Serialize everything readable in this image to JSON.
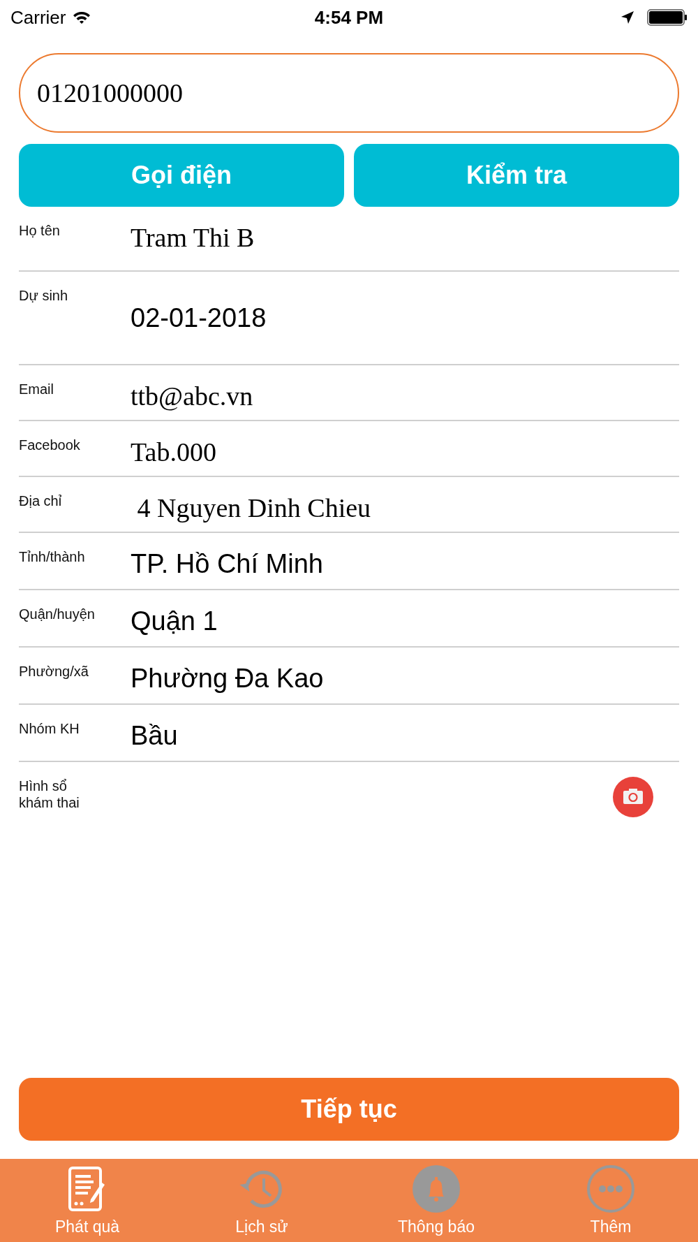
{
  "status_bar": {
    "carrier": "Carrier",
    "time": "4:54 PM"
  },
  "phone_field": {
    "value": "01201000000"
  },
  "action_buttons": [
    "Gọi điện",
    "Kiểm tra"
  ],
  "fields": [
    {
      "label": "Họ tên",
      "value": "Tram Thi B",
      "kind": "input"
    },
    {
      "label": "Dự sinh",
      "value": "02-01-2018",
      "kind": "picker",
      "tall": true
    },
    {
      "label": "Email",
      "value": "ttb@abc.vn",
      "kind": "input"
    },
    {
      "label": "Facebook",
      "value": "Tab.000",
      "kind": "input"
    },
    {
      "label": "Địa chỉ",
      "value": " 4 Nguyen Dinh Chieu",
      "kind": "input"
    },
    {
      "label": "Tỉnh/thành",
      "value": "TP. Hồ Chí Minh",
      "kind": "picker"
    },
    {
      "label": "Quận/huyện",
      "value": "Quận 1",
      "kind": "picker"
    },
    {
      "label": "Phường/xã",
      "value": "Phường Đa Kao",
      "kind": "picker"
    },
    {
      "label": "Nhóm KH",
      "value": "Bầu",
      "kind": "picker"
    },
    {
      "label": "Hình sổ khám thai",
      "kind": "photo"
    }
  ],
  "continue_button": "Tiếp tục",
  "tabs": [
    {
      "label": "Phát quà",
      "kind": "gift",
      "selected": true
    },
    {
      "label": "Lịch sử",
      "kind": "history",
      "selected": false
    },
    {
      "label": "Thông báo",
      "kind": "bell",
      "selected": false
    },
    {
      "label": "Thêm",
      "kind": "more",
      "selected": false
    }
  ]
}
